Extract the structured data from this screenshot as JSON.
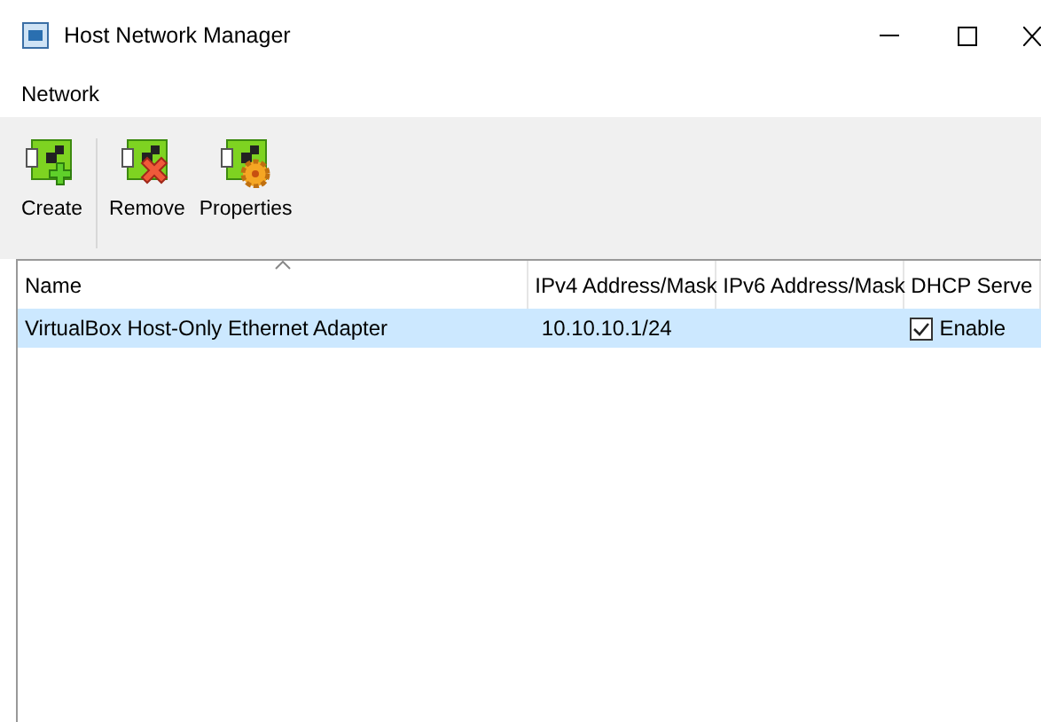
{
  "window": {
    "title": "Host Network Manager"
  },
  "menu": [
    "Network"
  ],
  "toolbar": [
    {
      "kind": "create",
      "label": "Create"
    },
    {
      "kind": "remove",
      "label": "Remove"
    },
    {
      "kind": "properties",
      "label": "Properties"
    }
  ],
  "table": {
    "columns": [
      "Name",
      "IPv4 Address/Mask",
      "IPv6 Address/Mask",
      "DHCP Serve"
    ],
    "rows": [
      {
        "selected": true,
        "name": "VirtualBox Host-Only Ethernet Adapter",
        "ipv4": "10.10.10.1/24",
        "ipv6": "",
        "dhcp_checked": true,
        "dhcp": "Enable"
      }
    ]
  }
}
